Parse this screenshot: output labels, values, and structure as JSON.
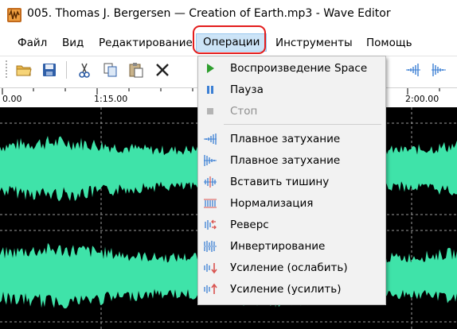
{
  "window": {
    "title": "005. Thomas J. Bergersen — Creation of Earth.mp3 - Wave Editor",
    "icon": "wave-editor-app-icon"
  },
  "menubar": {
    "items": [
      {
        "label": "Файл"
      },
      {
        "label": "Вид"
      },
      {
        "label": "Редактирование"
      },
      {
        "label": "Операции",
        "active": true
      },
      {
        "label": "Инструменты"
      },
      {
        "label": "Помощь"
      }
    ]
  },
  "toolbar": {
    "buttons": [
      "open-folder-icon",
      "save-icon",
      "cut-icon",
      "copy-icon",
      "paste-icon",
      "delete-icon",
      "fade-in-icon",
      "fade-out-icon"
    ]
  },
  "ruler": {
    "ticks": [
      "0.00",
      "1:15.00",
      "2:00.00"
    ]
  },
  "waveform": {
    "colors": {
      "background": "#000000",
      "wave": "#3fe3a9",
      "grid": "#9a9a9a"
    }
  },
  "operations_menu": {
    "items": [
      {
        "label": "Воспроизведение",
        "shortcut": "Space",
        "icon": "play-icon",
        "enabled": true
      },
      {
        "label": "Пауза",
        "icon": "pause-icon",
        "enabled": true
      },
      {
        "label": "Стоп",
        "icon": "stop-icon",
        "enabled": false
      },
      {
        "label": "Плавное затухание",
        "icon": "fade-in-icon",
        "enabled": true
      },
      {
        "label": "Плавное затухание",
        "icon": "fade-out-icon",
        "enabled": true
      },
      {
        "label": "Вставить тишину",
        "icon": "insert-silence-icon",
        "enabled": true
      },
      {
        "label": "Нормализация",
        "icon": "normalize-icon",
        "enabled": true
      },
      {
        "label": "Реверс",
        "icon": "reverse-icon",
        "enabled": true
      },
      {
        "label": "Инвертирование",
        "icon": "invert-icon",
        "enabled": true
      },
      {
        "label": "Усиление (ослабить)",
        "icon": "amplify-decrease-icon",
        "enabled": true
      },
      {
        "label": "Усиление (усилить)",
        "icon": "amplify-increase-icon",
        "enabled": true
      }
    ]
  },
  "accent": {
    "highlight_ring": "#e31c1c",
    "menu_active_bg": "#cce4f7",
    "icon_blue": "#3b7fd4"
  }
}
